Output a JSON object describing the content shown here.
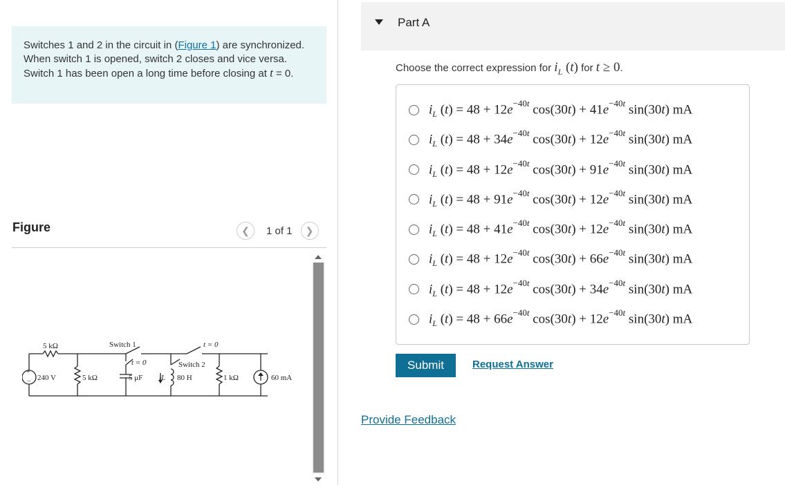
{
  "problem": {
    "text_before_link": "Switches 1 and 2 in the circuit in (",
    "link": "Figure 1",
    "text_after_link": ") are synchronized. When switch 1 is opened, switch 2 closes and vice versa. Switch 1 has been open a long time before closing at ",
    "t_var": "t",
    "text_end": " = 0."
  },
  "figure": {
    "title": "Figure",
    "pager_text": "1 of 1",
    "prev_icon": "chevron-left-icon",
    "next_icon": "chevron-right-icon",
    "circuit_labels": {
      "r1": "5 kΩ",
      "switch1": "Switch 1",
      "t0_top": "t = 0",
      "t0_mid": "t = 0",
      "switch2": "Switch 2",
      "vsource": "240 V",
      "r2": "5 kΩ",
      "cap": "5 μF",
      "il": "iL",
      "ind": "80 H",
      "r3": "1 kΩ",
      "isource": "60 mA"
    }
  },
  "part": {
    "title": "Part A",
    "caret_icon": "caret-down-icon",
    "question_prefix": "Choose the correct expression for ",
    "question_mid": " for ",
    "options": [
      {
        "c1": "12",
        "c2": "41"
      },
      {
        "c1": "34",
        "c2": "12"
      },
      {
        "c1": "12",
        "c2": "91"
      },
      {
        "c1": "91",
        "c2": "12"
      },
      {
        "c1": "41",
        "c2": "12"
      },
      {
        "c1": "12",
        "c2": "66"
      },
      {
        "c1": "12",
        "c2": "34"
      },
      {
        "c1": "66",
        "c2": "12"
      }
    ],
    "submit_label": "Submit",
    "request_answer_label": "Request Answer"
  },
  "feedback_label": "Provide Feedback",
  "colors": {
    "accent": "#0f6f95",
    "problem_bg": "#e8f5f7",
    "header_bg": "#f2f2f2"
  }
}
